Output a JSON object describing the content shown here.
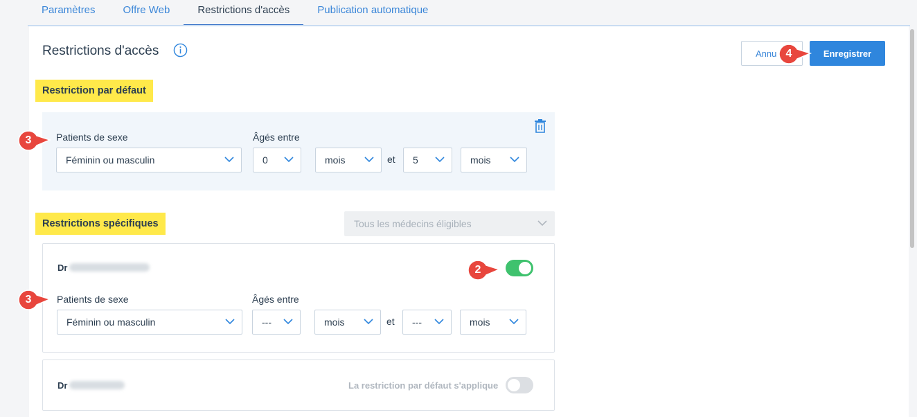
{
  "tabs": [
    {
      "label": "Paramètres"
    },
    {
      "label": "Offre Web"
    },
    {
      "label": "Restrictions d'accès"
    },
    {
      "label": "Publication automatique"
    }
  ],
  "page": {
    "title": "Restrictions d'accès"
  },
  "actions": {
    "cancel_label": "Annu",
    "save_label": "Enregistrer"
  },
  "default_restriction": {
    "heading": "Restriction par défaut",
    "sex_label": "Patients de sexe",
    "sex_value": "Féminin ou masculin",
    "age_label": "Âgés entre",
    "age_min": "0",
    "age_min_unit": "mois",
    "and_label": "et",
    "age_max": "5",
    "age_max_unit": "mois"
  },
  "specific": {
    "heading": "Restrictions spécifiques",
    "doctor_filter": "Tous les médecins éligibles",
    "cards": [
      {
        "doctor_prefix": "Dr",
        "sex_label": "Patients de sexe",
        "sex_value": "Féminin ou masculin",
        "age_label": "Âgés entre",
        "age_min": "---",
        "age_min_unit": "mois",
        "and_label": "et",
        "age_max": "---",
        "age_max_unit": "mois",
        "toggle_on": true
      },
      {
        "doctor_prefix": "Dr",
        "note": "La restriction par défaut s'applique",
        "toggle_on": false
      }
    ]
  },
  "callouts": {
    "c1": "3",
    "c2": "2",
    "c3": "3",
    "c4": "4"
  },
  "colors": {
    "accent": "#2f86dd",
    "highlight": "#ffe94a",
    "toggle_on": "#3fc26e",
    "callout": "#e8463d"
  }
}
